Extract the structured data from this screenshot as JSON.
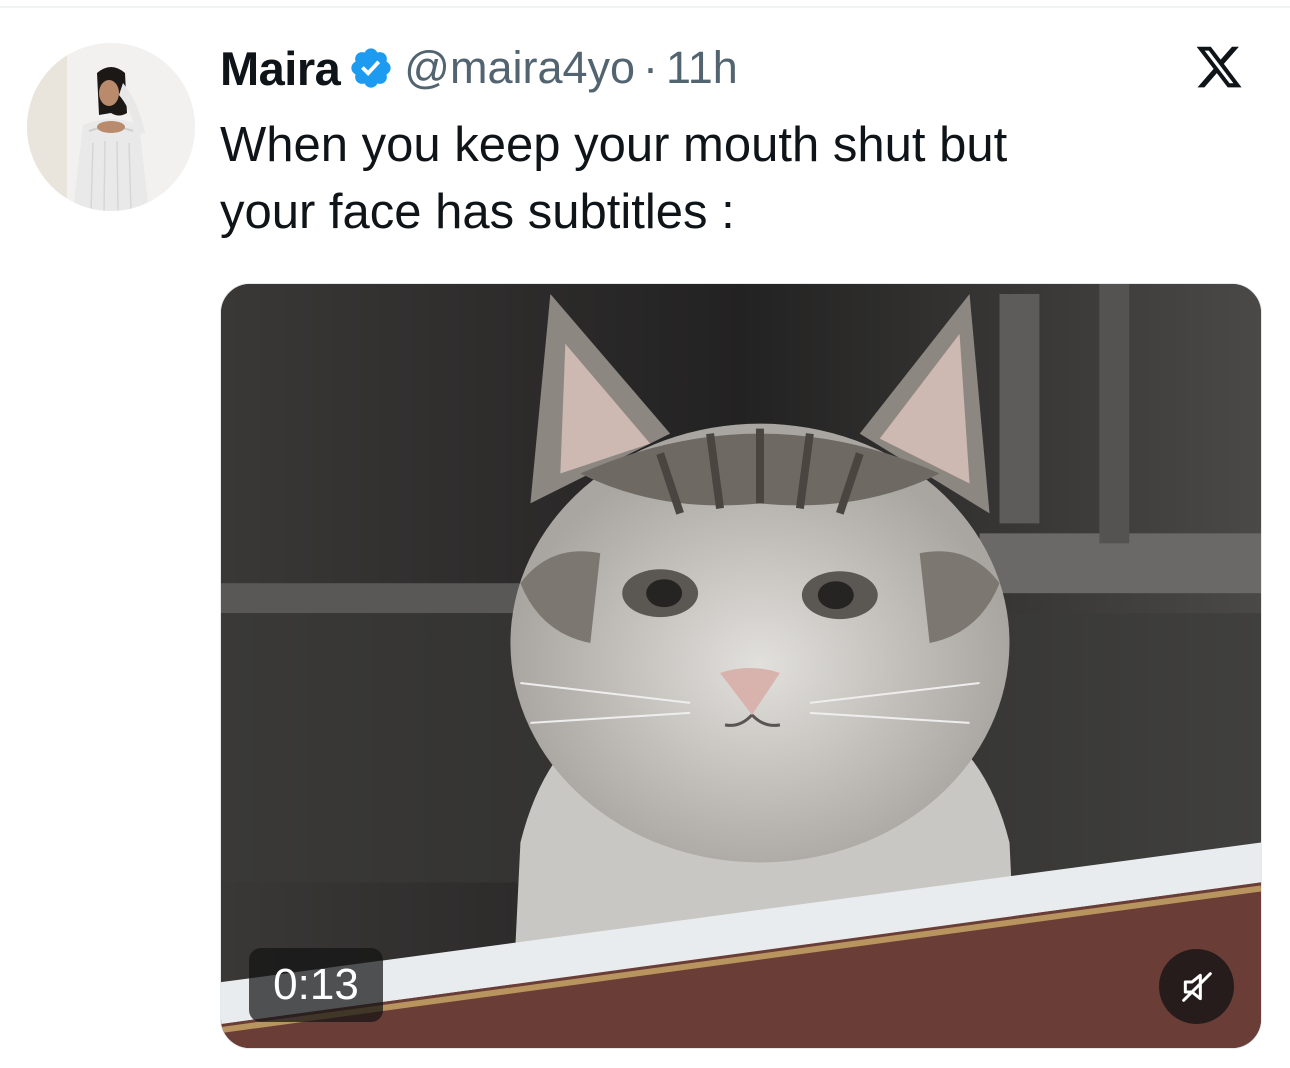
{
  "tweet": {
    "author": {
      "display_name": "Maira",
      "handle": "@maira4yo",
      "verified": true,
      "avatar": "profile-photo"
    },
    "separator": "·",
    "time": "11h",
    "text_lines": [
      "When you keep your mouth shut but",
      "your face has subtitles :"
    ]
  },
  "media": {
    "type": "video",
    "description_icon": "cat-video",
    "duration": "0:13",
    "mute_icon": "muted-speaker-icon"
  },
  "platform": {
    "logo_icon": "x-logo-icon"
  },
  "colors": {
    "text_primary": "#0f1419",
    "text_secondary": "#536471",
    "verified_blue": "#1d9bf0"
  }
}
